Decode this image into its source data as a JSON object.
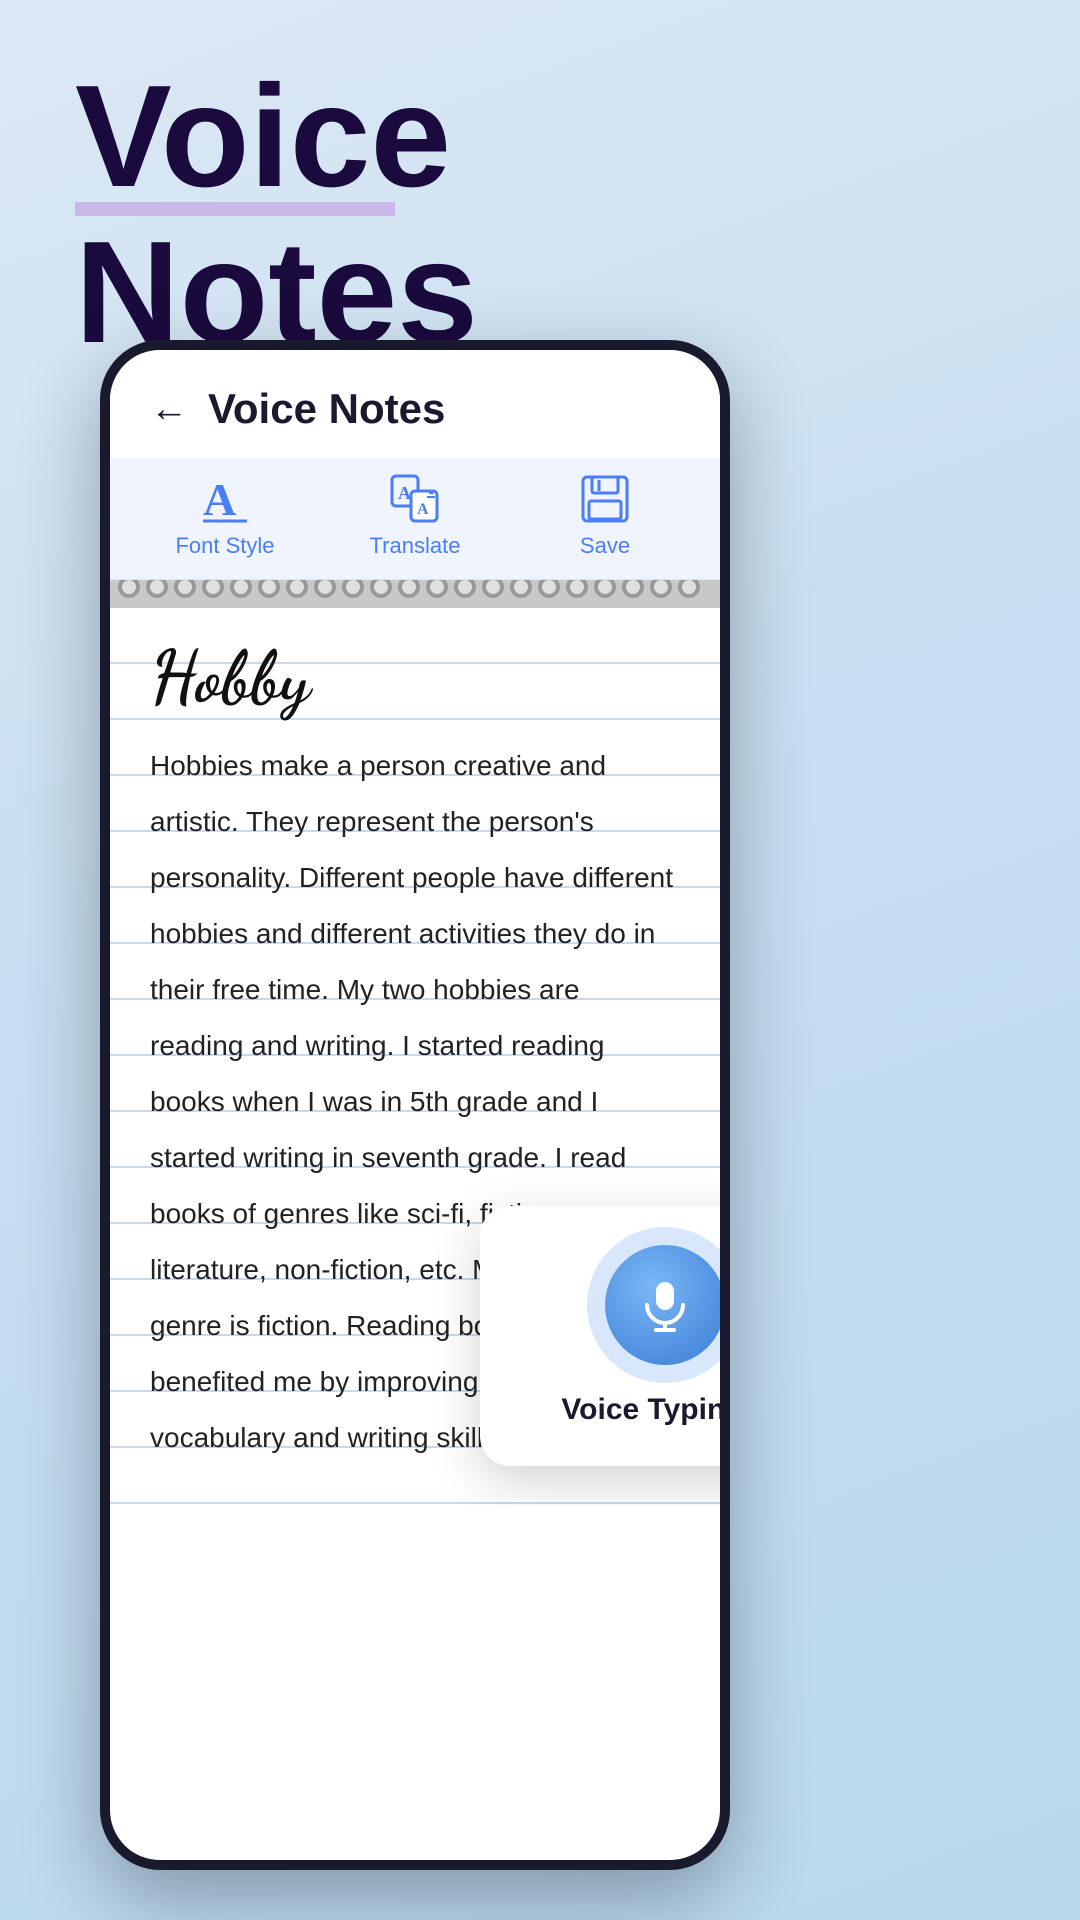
{
  "background": {
    "title_line1": "Voice",
    "title_line2": "Notes"
  },
  "app": {
    "header": {
      "back_label": "←",
      "title": "Voice Notes"
    },
    "toolbar": {
      "font_style_label": "Font Style",
      "translate_label": "Translate",
      "save_label": "Save"
    },
    "note": {
      "title": "Hobby",
      "body": "Hobbies make a person creative and artistic. They represent the person's personality. Different  people have different hobbies and different activities they do in their free time. My two hobbies are reading and writing. I started reading books when I was in 5th grade and I started writing in seventh grade. I read books of genres like sci-fi, fiction, literature, non-fiction, etc. My favourite genre is fiction. Reading books has benefited me by improving my English vocabulary and writing skills."
    },
    "voice_popup": {
      "label": "Voice Typing..."
    }
  }
}
